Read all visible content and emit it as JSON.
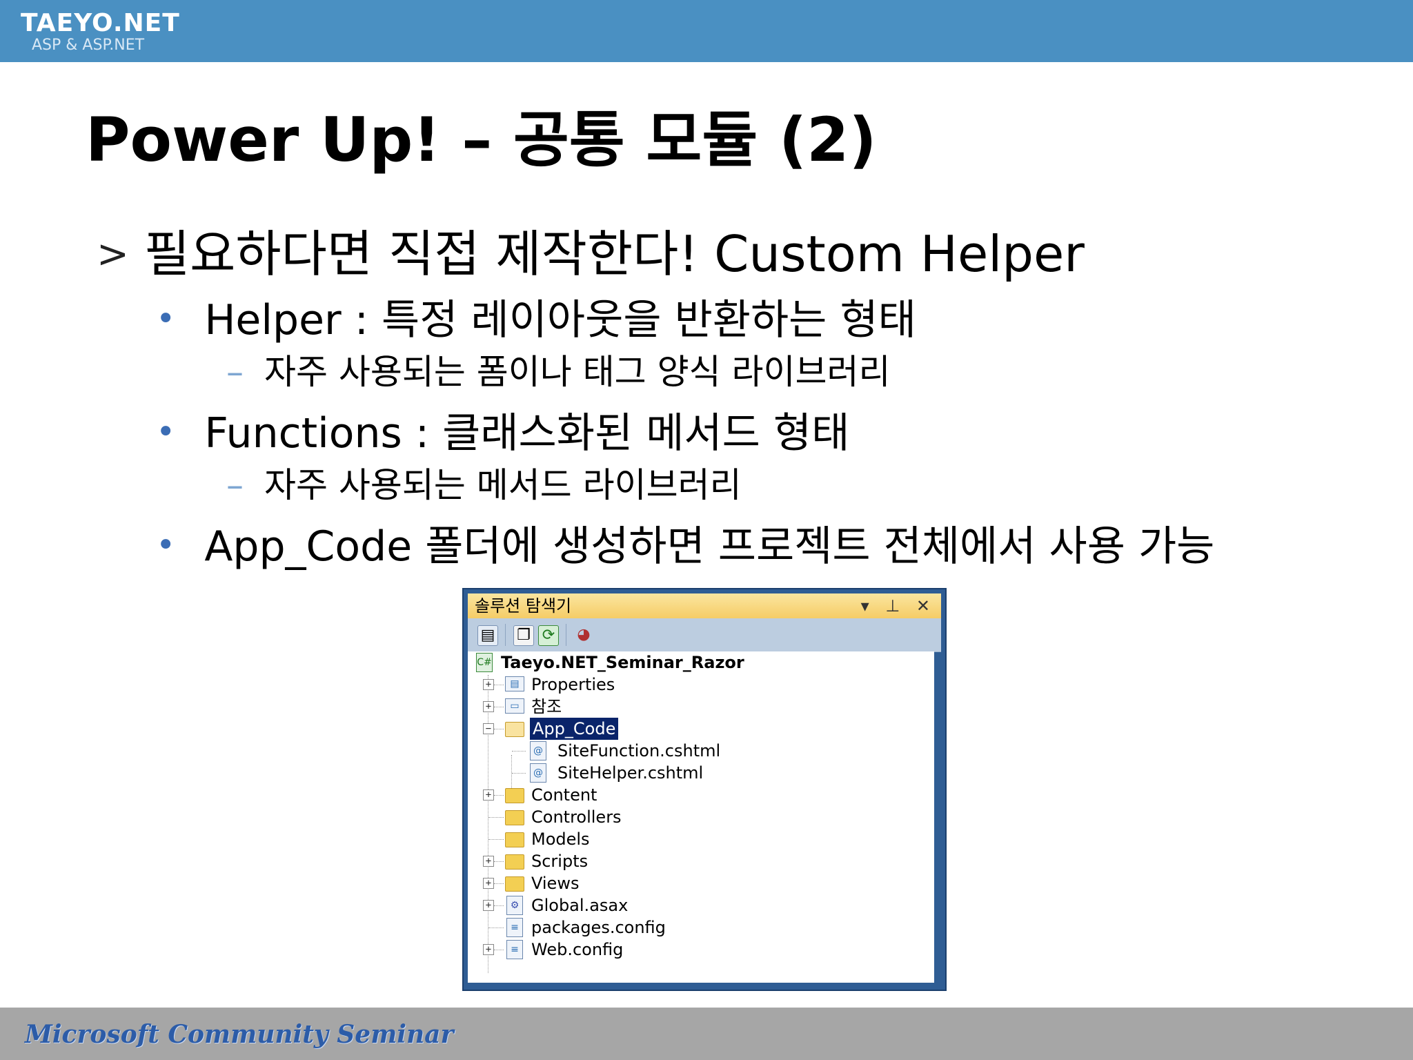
{
  "header": {
    "logo_title": "TAEYO.NET",
    "logo_subtitle": "ASP & ASP.NET",
    "band_color": "#4a90c2"
  },
  "slide": {
    "title": "Power Up! – 공통 모듈 (2)",
    "heading": {
      "marker": ">",
      "text": "필요하다면 직접 제작한다! Custom Helper"
    },
    "bullets": [
      {
        "marker": "•",
        "text": "Helper : 특정 레이아웃을 반환하는 형태",
        "sub": {
          "marker": "–",
          "text": "자주 사용되는 폼이나 태그 양식 라이브러리"
        }
      },
      {
        "marker": "•",
        "text": "Functions : 클래스화된 메서드 형태",
        "sub": {
          "marker": "–",
          "text": "자주 사용되는 메서드 라이브러리"
        }
      },
      {
        "marker": "•",
        "text": "App_Code 폴더에 생성하면 프로젝트 전체에서 사용 가능"
      }
    ]
  },
  "solution_explorer": {
    "title": "솔루션 탐색기",
    "title_controls": "▾ ⊥ ✕",
    "toolbar_icons": [
      "properties-icon",
      "show-all-files-icon",
      "refresh-icon",
      "class-diagram-icon"
    ],
    "project": "Taeyo.NET_Seminar_Razor",
    "items": [
      {
        "label": "Properties",
        "type": "special-folder",
        "expander": "+"
      },
      {
        "label": "참조",
        "type": "references",
        "expander": "+"
      },
      {
        "label": "App_Code",
        "type": "folder-open",
        "expander": "−",
        "selected": true
      },
      {
        "label": "SiteFunction.cshtml",
        "type": "cshtml",
        "expander": ""
      },
      {
        "label": "SiteHelper.cshtml",
        "type": "cshtml",
        "expander": ""
      },
      {
        "label": "Content",
        "type": "folder",
        "expander": "+"
      },
      {
        "label": "Controllers",
        "type": "folder",
        "expander": ""
      },
      {
        "label": "Models",
        "type": "folder",
        "expander": ""
      },
      {
        "label": "Scripts",
        "type": "folder",
        "expander": "+"
      },
      {
        "label": "Views",
        "type": "folder",
        "expander": "+"
      },
      {
        "label": "Global.asax",
        "type": "asax",
        "expander": "+"
      },
      {
        "label": "packages.config",
        "type": "config",
        "expander": ""
      },
      {
        "label": "Web.config",
        "type": "config",
        "expander": "+"
      }
    ]
  },
  "footer": {
    "text": "Microsoft Community Seminar",
    "band_color": "#a6a6a6"
  }
}
